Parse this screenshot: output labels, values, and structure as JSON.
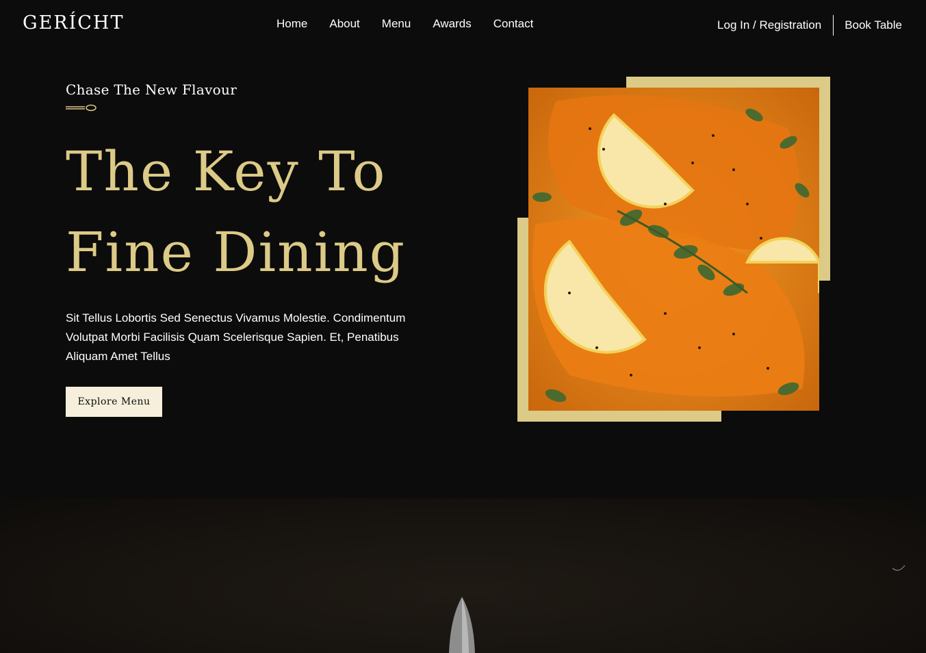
{
  "nav": {
    "logo": "GERÍCHT",
    "links": [
      "Home",
      "About",
      "Menu",
      "Awards",
      "Contact"
    ],
    "login": "Log In / Registration",
    "book": "Book Table"
  },
  "hero": {
    "subtitle": "Chase The New Flavour",
    "headline_line1": "The Key To",
    "headline_line2": "Fine Dining",
    "paragraph": "Sit Tellus Lobortis Sed Senectus Vivamus Molestie. Condimentum Volutpat Morbi Facilisis Quam Scelerisque Sapien. Et, Penatibus Aliquam Amet Tellus",
    "cta": "Explore Menu"
  },
  "colors": {
    "background": "#0c0c0c",
    "accent_gold": "#dcca87",
    "button_bg": "#f5efdb"
  },
  "icons": [
    "spoon-icon",
    "knife-icon"
  ]
}
